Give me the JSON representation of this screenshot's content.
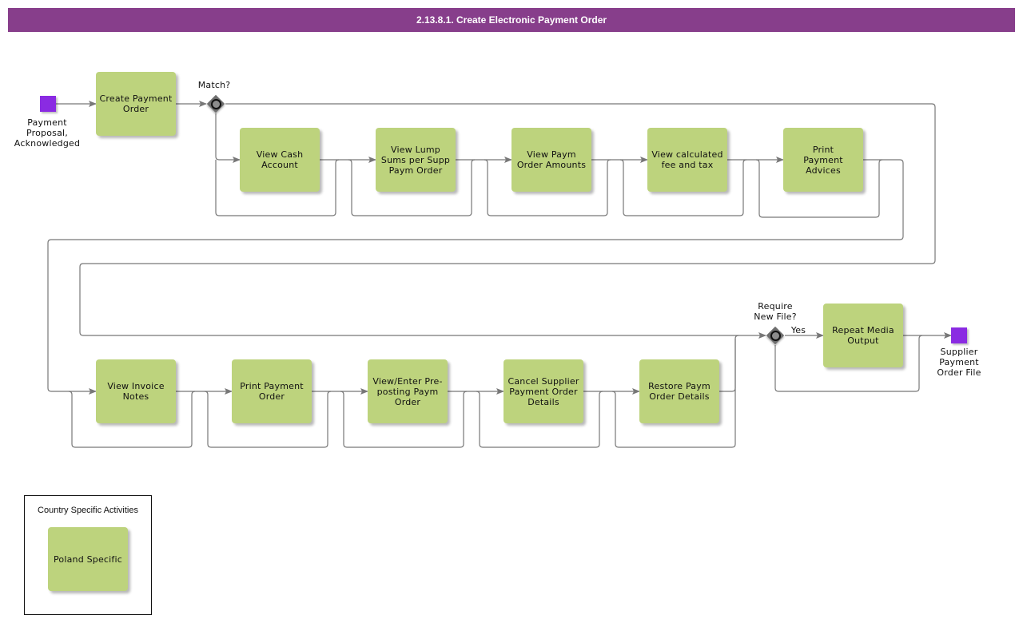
{
  "title": "2.13.8.1. Create Electronic Payment Order",
  "colors": {
    "title_bar": "#873e8b",
    "task_fill": "#bdd37d",
    "event_fill": "#8a2be2",
    "gateway_fill": "#6e6e6e",
    "connector": "#777777"
  },
  "events": {
    "start": {
      "label": "Payment\nProposal,\nAcknowledged",
      "icon": "start-event-square"
    },
    "end": {
      "label": "Supplier\nPayment\nOrder File",
      "icon": "end-event-square"
    }
  },
  "gateways": {
    "match": {
      "label": "Match?",
      "icon": "inclusive-gateway-circle-diamond"
    },
    "require_new_file": {
      "label": "Require\nNew File?",
      "icon": "inclusive-gateway-circle-diamond",
      "yes_label": "Yes"
    }
  },
  "tasks": {
    "create_payment_order": "Create Payment\nOrder",
    "row1": [
      "View Cash\nAccount",
      "View Lump\nSums per Supp\nPaym Order",
      "View Paym\nOrder Amounts",
      "View calculated\nfee and tax",
      "Print\nPayment\nAdvices"
    ],
    "row2": [
      "View Invoice\nNotes",
      "Print Payment\nOrder",
      "View/Enter Pre-\nposting Paym\nOrder",
      "Cancel Supplier\nPayment Order\nDetails",
      "Restore Paym\nOrder Details"
    ],
    "repeat_media_output": "Repeat Media\nOutput"
  },
  "legend": {
    "title": "Country Specific Activities",
    "items": [
      "Poland Specific"
    ]
  }
}
